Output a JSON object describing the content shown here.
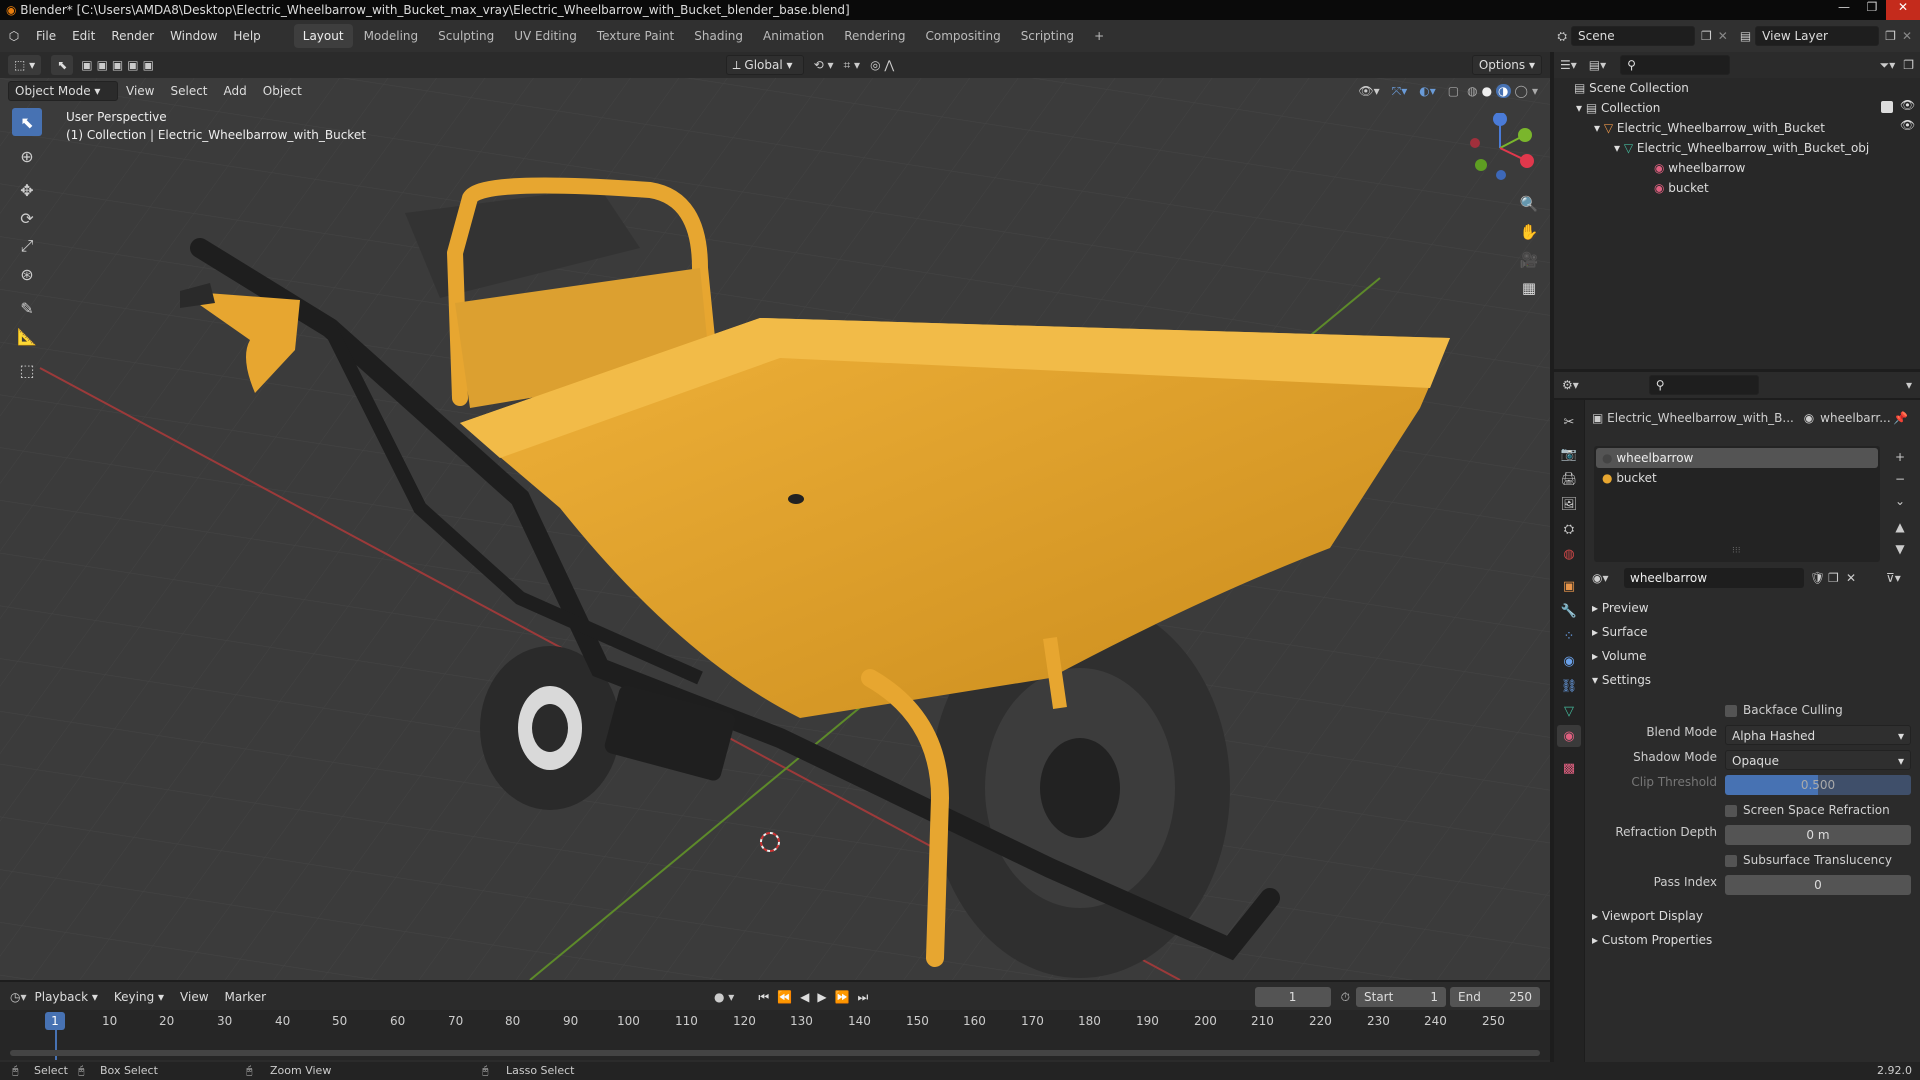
{
  "window": {
    "title": "Blender* [C:\\Users\\AMDA8\\Desktop\\Electric_Wheelbarrow_with_Bucket_max_vray\\Electric_Wheelbarrow_with_Bucket_blender_base.blend]"
  },
  "menus": [
    "File",
    "Edit",
    "Render",
    "Window",
    "Help"
  ],
  "workspaces": [
    "Layout",
    "Modeling",
    "Sculpting",
    "UV Editing",
    "Texture Paint",
    "Shading",
    "Animation",
    "Rendering",
    "Compositing",
    "Scripting"
  ],
  "active_workspace": "Layout",
  "scene": {
    "name": "Scene",
    "view_layer": "View Layer"
  },
  "viewport": {
    "mode": "Object Mode",
    "menu": [
      "View",
      "Select",
      "Add",
      "Object"
    ],
    "transform": "Global",
    "options": "Options",
    "overlay_title": "User Perspective",
    "overlay_sub": "(1) Collection | Electric_Wheelbarrow_with_Bucket"
  },
  "outliner": {
    "root": "Scene Collection",
    "collection": "Collection",
    "object": "Electric_Wheelbarrow_with_Bucket",
    "mesh": "Electric_Wheelbarrow_with_Bucket_obj",
    "materials": [
      "wheelbarrow",
      "bucket"
    ]
  },
  "properties": {
    "object_name": "Electric_Wheelbarrow_with_B...",
    "material_crumb": "wheelbarr...",
    "slots": [
      "wheelbarrow",
      "bucket"
    ],
    "material": "wheelbarrow",
    "panels": {
      "preview": "Preview",
      "surface": "Surface",
      "volume": "Volume",
      "settings": "Settings",
      "viewport_display": "Viewport Display",
      "custom_properties": "Custom Properties"
    },
    "settings": {
      "backface_culling": "Backface Culling",
      "blend_mode_label": "Blend Mode",
      "blend_mode": "Alpha Hashed",
      "shadow_mode_label": "Shadow Mode",
      "shadow_mode": "Opaque",
      "clip_threshold_label": "Clip Threshold",
      "clip_threshold": "0.500",
      "ssr": "Screen Space Refraction",
      "refraction_depth_label": "Refraction Depth",
      "refraction_depth": "0 m",
      "subsurface": "Subsurface Translucency",
      "pass_index_label": "Pass Index",
      "pass_index": "0"
    }
  },
  "timeline": {
    "menus": [
      "Playback",
      "Keying",
      "View",
      "Marker"
    ],
    "current_frame": "1",
    "start_label": "Start",
    "start": "1",
    "end_label": "End",
    "end": "250",
    "ticks": [
      "1",
      "10",
      "20",
      "30",
      "40",
      "50",
      "60",
      "70",
      "80",
      "90",
      "100",
      "110",
      "120",
      "130",
      "140",
      "150",
      "160",
      "170",
      "180",
      "190",
      "200",
      "210",
      "220",
      "230",
      "240",
      "250"
    ]
  },
  "status": {
    "select": "Select",
    "box_select": "Box Select",
    "zoom_view": "Zoom View",
    "lasso_select": "Lasso Select",
    "version": "2.92.0"
  },
  "colors": {
    "accent": "#4772b3",
    "bucket": "#e7a630",
    "grid_x": "#9c3a3a",
    "grid_y": "#5d8a2a"
  }
}
